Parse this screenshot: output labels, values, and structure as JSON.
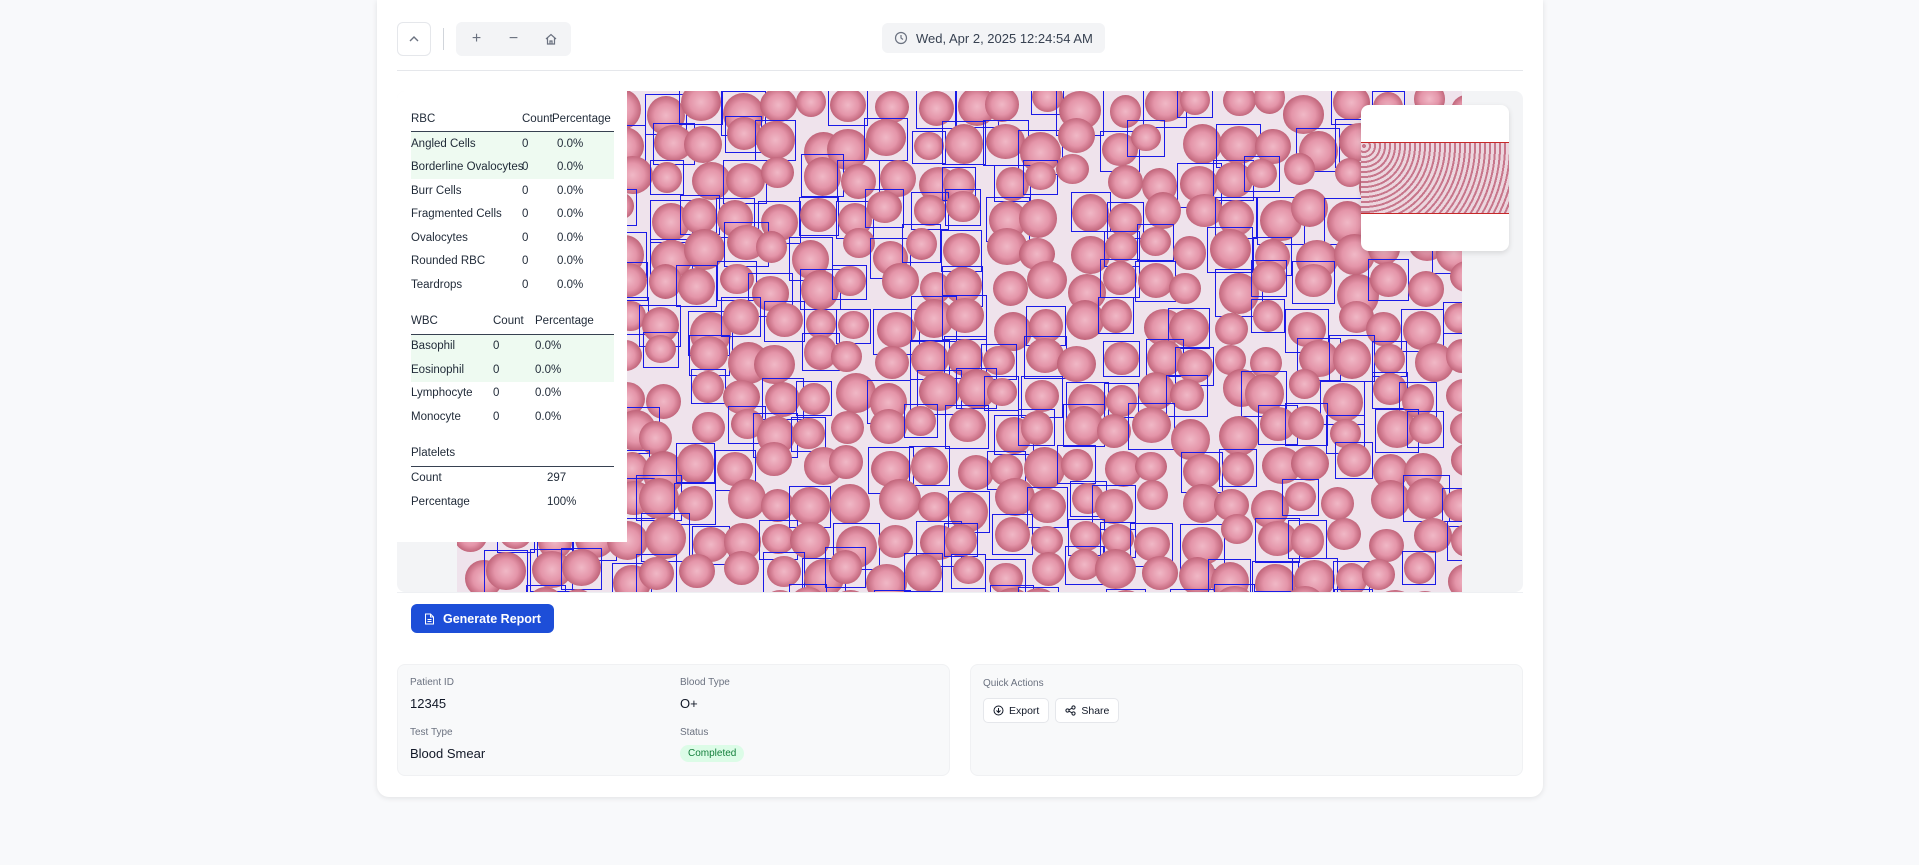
{
  "toolbar": {
    "collapse_icon": "chevron-up-icon",
    "zoom_in_label": "+",
    "zoom_out_label": "−",
    "home_icon": "home-icon",
    "datetime": "Wed, Apr 2, 2025 12:24:54 AM"
  },
  "stats": {
    "rbc": {
      "headers": [
        "RBC",
        "Count",
        "Percentage"
      ],
      "rows": [
        {
          "name": "Angled Cells",
          "count": "0",
          "pct": "0.0%"
        },
        {
          "name": "Borderline Ovalocytes",
          "count": "0",
          "pct": "0.0%"
        },
        {
          "name": "Burr Cells",
          "count": "0",
          "pct": "0.0%"
        },
        {
          "name": "Fragmented Cells",
          "count": "0",
          "pct": "0.0%"
        },
        {
          "name": "Ovalocytes",
          "count": "0",
          "pct": "0.0%"
        },
        {
          "name": "Rounded RBC",
          "count": "0",
          "pct": "0.0%"
        },
        {
          "name": "Teardrops",
          "count": "0",
          "pct": "0.0%"
        }
      ]
    },
    "wbc": {
      "headers": [
        "WBC",
        "Count",
        "Percentage"
      ],
      "rows": [
        {
          "name": "Basophil",
          "count": "0",
          "pct": "0.0%"
        },
        {
          "name": "Eosinophil",
          "count": "0",
          "pct": "0.0%"
        },
        {
          "name": "Lymphocyte",
          "count": "0",
          "pct": "0.0%"
        },
        {
          "name": "Monocyte",
          "count": "0",
          "pct": "0.0%"
        }
      ]
    },
    "platelets": {
      "title": "Platelets",
      "count_label": "Count",
      "count_value": "297",
      "pct_label": "Percentage",
      "pct_value": "100%"
    }
  },
  "actions": {
    "generate_report": "Generate Report"
  },
  "patient": {
    "id_label": "Patient ID",
    "id_value": "12345",
    "blood_type_label": "Blood Type",
    "blood_type_value": "O+",
    "test_type_label": "Test Type",
    "test_type_value": "Blood Smear",
    "status_label": "Status",
    "status_value": "Completed"
  },
  "quick_actions": {
    "title": "Quick Actions",
    "export_label": "Export",
    "share_label": "Share"
  },
  "colors": {
    "primary": "#1d4ed8",
    "bbox": "#1a1ae6",
    "status_bg": "#dcfce7",
    "status_text": "#15803d",
    "highlight_row": "#eefaf1"
  }
}
